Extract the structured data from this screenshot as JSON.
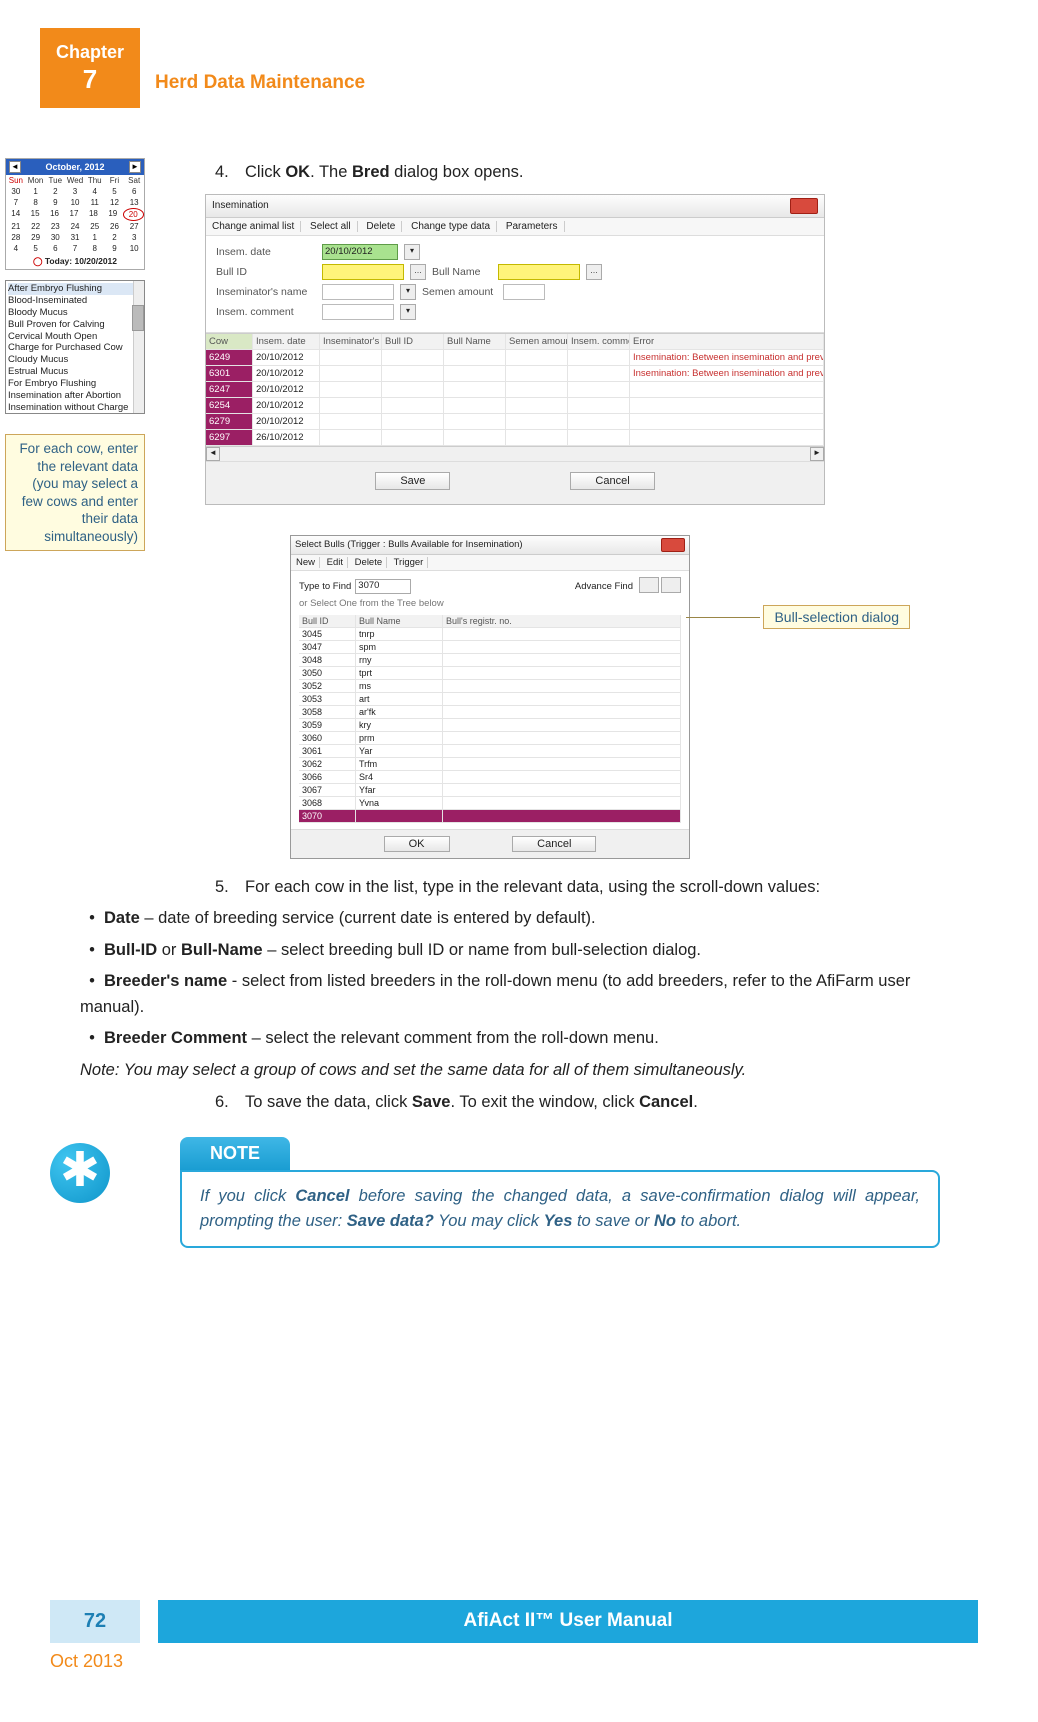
{
  "header": {
    "chapter_word": "Chapter",
    "chapter_num": "7",
    "section_title": "Herd Data Maintenance"
  },
  "side": {
    "cal_month": "October, 2012",
    "cal_today": "Today: 10/20/2012",
    "cal_days": [
      "Sun",
      "Mon",
      "Tue",
      "Wed",
      "Thu",
      "Fri",
      "Sat"
    ],
    "cal_weeks": [
      [
        "30",
        "1",
        "2",
        "3",
        "4",
        "5",
        "6"
      ],
      [
        "7",
        "8",
        "9",
        "10",
        "11",
        "12",
        "13"
      ],
      [
        "14",
        "15",
        "16",
        "17",
        "18",
        "19",
        "20"
      ],
      [
        "21",
        "22",
        "23",
        "24",
        "25",
        "26",
        "27"
      ],
      [
        "28",
        "29",
        "30",
        "31",
        "1",
        "2",
        "3"
      ],
      [
        "4",
        "5",
        "6",
        "7",
        "8",
        "9",
        "10"
      ]
    ],
    "list_items": [
      "After Embryo Flushing",
      "Blood-Inseminated",
      "Bloody Mucus",
      "Bull Proven for Calving",
      "Cervical Mouth Open",
      "Charge for Purchased Cow",
      "Cloudy Mucus",
      "Estrual Mucus",
      "For Embryo Flushing",
      "Insemination after Abortion",
      "Insemination without Charge"
    ],
    "callout_text": "For each cow, enter the relevant data (you may select a few cows and enter their data simultaneously)"
  },
  "screenshot1": {
    "title": "Insemination",
    "toolbar": {
      "change_list": "Change animal list",
      "select_all": "Select all",
      "delete": "Delete",
      "change_type": "Change type data",
      "parameters": "Parameters"
    },
    "labels": {
      "insem_date": "Insem. date",
      "insem_date_val": "20/10/2012",
      "bull_id": "Bull ID",
      "bull_name": "Bull Name",
      "inseminator": "Inseminator's name",
      "semen_amount": "Semen amount",
      "insem_comment": "Insem. comment"
    },
    "grid_headers": [
      "Cow",
      "Insem. date",
      "Inseminator's name",
      "Bull ID",
      "Bull Name",
      "Semen amount",
      "Insem. comment",
      "Error"
    ],
    "rows": [
      {
        "cow": "6249",
        "date": "20/10/2012",
        "err": "Insemination: Between insemination and previous insemination there must b"
      },
      {
        "cow": "6301",
        "date": "20/10/2012",
        "err": "Insemination: Between insemination and previous insemination there must b"
      },
      {
        "cow": "6247",
        "date": "20/10/2012",
        "err": ""
      },
      {
        "cow": "6254",
        "date": "20/10/2012",
        "err": ""
      },
      {
        "cow": "6279",
        "date": "20/10/2012",
        "err": ""
      },
      {
        "cow": "6297",
        "date": "26/10/2012",
        "err": ""
      }
    ],
    "save_btn": "Save",
    "cancel_btn": "Cancel"
  },
  "screenshot2": {
    "title": "Select Bulls (Trigger : Bulls Available for Insemination)",
    "toolbar": {
      "new": "New",
      "edit": "Edit",
      "delete": "Delete",
      "trigger": "Trigger"
    },
    "type_find": "Type to Find",
    "type_val": "3070",
    "adv_find": "Advance Find",
    "or_select": "or Select One from the Tree below",
    "grid_headers": [
      "Bull ID",
      "Bull Name",
      "Bull's registr. no."
    ],
    "rows": [
      {
        "id": "3045",
        "name": "tnrp"
      },
      {
        "id": "3047",
        "name": "spm"
      },
      {
        "id": "3048",
        "name": "rny"
      },
      {
        "id": "3050",
        "name": "tprt"
      },
      {
        "id": "3052",
        "name": "ms"
      },
      {
        "id": "3053",
        "name": "art"
      },
      {
        "id": "3058",
        "name": "ar'fk"
      },
      {
        "id": "3059",
        "name": "kry"
      },
      {
        "id": "3060",
        "name": "prm"
      },
      {
        "id": "3061",
        "name": "Yar"
      },
      {
        "id": "3062",
        "name": "Trfm"
      },
      {
        "id": "3066",
        "name": "Sr4"
      },
      {
        "id": "3067",
        "name": "Yfar"
      },
      {
        "id": "3068",
        "name": "Yvna"
      }
    ],
    "sel_row": {
      "id": "3070",
      "name": ""
    },
    "ok_btn": "OK",
    "cancel_btn": "Cancel",
    "callout": "Bull-selection dialog"
  },
  "instructions": {
    "step4_pre": "Click ",
    "step4_bold1": "OK",
    "step4_mid": ". The ",
    "step4_bold2": "Bred",
    "step4_post": " dialog box opens.",
    "step5": "For each cow in the list, type in the relevant data, using the scroll-down values:",
    "b_date_label": "Date",
    "b_date_text": " – date of breeding service (current date is entered by default).",
    "b_bullid_label1": "Bull-ID",
    "b_bullid_or": " or ",
    "b_bullid_label2": "Bull-Name",
    "b_bullid_text": " – select breeding bull ID or name from bull-selection dialog.",
    "b_breeder_label": "Breeder's name",
    "b_breeder_text": " - select from listed breeders in the roll-down menu (to add breeders, refer to the AfiFarm user manual).",
    "b_comment_label": "Breeder Comment",
    "b_comment_text": " – select the relevant comment from the roll-down menu.",
    "note_group": "Note: You may select a group of cows and set the same data for all of them simultaneously.",
    "step6_pre": "To save the data, click ",
    "step6_b1": "Save",
    "step6_mid": ". To exit the window, click ",
    "step6_b2": "Cancel",
    "step6_post": "."
  },
  "note": {
    "tab": "NOTE",
    "pre": "If you click ",
    "b1": "Cancel",
    "mid1": " before saving the changed data, a save-confirmation dialog will appear, prompting the user: ",
    "b2": "Save data?",
    "mid2": " You may click ",
    "b3": "Yes",
    "mid3": " to save or ",
    "b4": "No",
    "mid4": " to abort."
  },
  "footer": {
    "page": "72",
    "manual": "AfiAct II™ User Manual",
    "date": "Oct 2013"
  }
}
